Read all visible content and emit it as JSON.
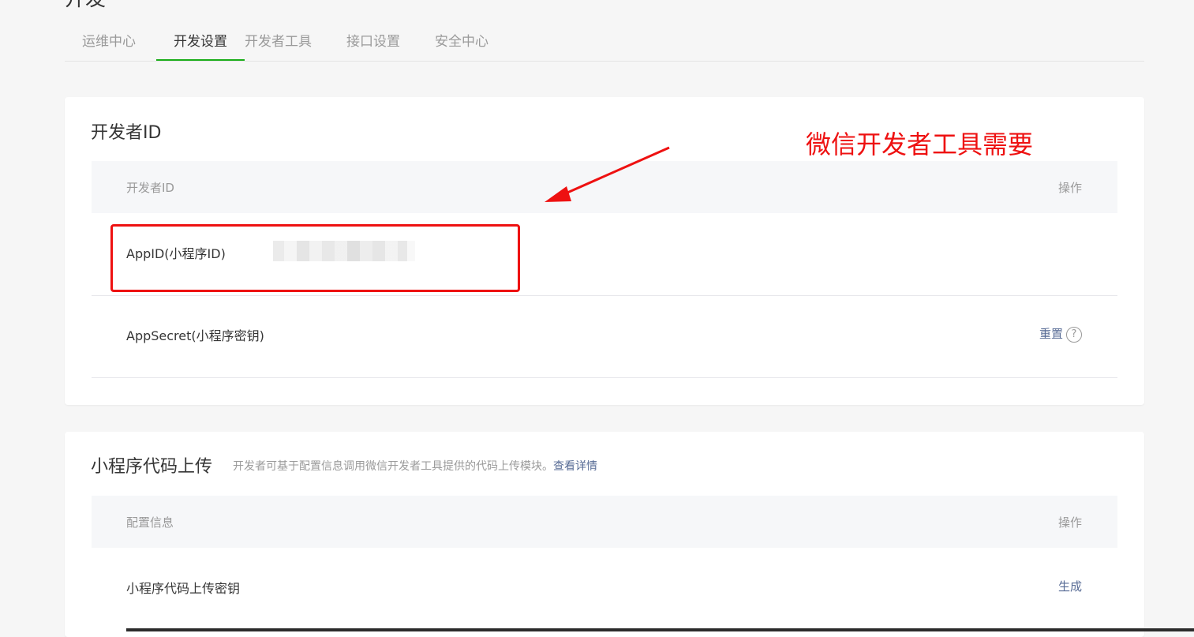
{
  "page": {
    "title": "开发"
  },
  "tabs": [
    {
      "label": "运维中心"
    },
    {
      "label": "开发设置"
    },
    {
      "label": "开发者工具"
    },
    {
      "label": "接口设置"
    },
    {
      "label": "安全中心"
    }
  ],
  "dev_id": {
    "title": "开发者ID",
    "col_name": "开发者ID",
    "col_op": "操作",
    "rows": [
      {
        "label": "AppID(小程序ID)"
      },
      {
        "label": "AppSecret(小程序密钥)",
        "op": "重置"
      }
    ]
  },
  "upload": {
    "title": "小程序代码上传",
    "desc": "开发者可基于配置信息调用微信开发者工具提供的代码上传模块。",
    "link": "查看详情",
    "col_name": "配置信息",
    "col_op": "操作",
    "rows": [
      {
        "label": "小程序代码上传密钥",
        "op": "生成"
      }
    ]
  },
  "annotation": {
    "text": "微信开发者工具需要",
    "color": "#ee1111"
  },
  "colors": {
    "accent_green": "#1aad19",
    "link_blue": "#576b95"
  },
  "icons": {
    "help": "question-circle-icon"
  }
}
